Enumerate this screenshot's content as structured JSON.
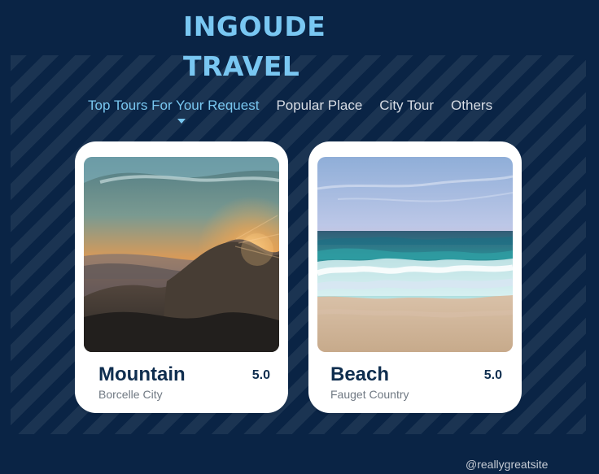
{
  "brand": {
    "line1": "INGOUDE",
    "line2": "TRAVEL"
  },
  "nav": {
    "items": [
      {
        "label": "Top Tours For Your Request"
      },
      {
        "label": "Popular Place"
      },
      {
        "label": "City Tour"
      },
      {
        "label": "Others"
      }
    ]
  },
  "cards": [
    {
      "title": "Mountain",
      "subtitle": "Borcelle City",
      "rating": "5.0",
      "image": "mountain-photo"
    },
    {
      "title": "Beach",
      "subtitle": "Fauget Country",
      "rating": "5.0",
      "image": "beach-photo"
    }
  ],
  "footer": {
    "site": "@reallygreatsite"
  },
  "colors": {
    "background": "#0a2445",
    "accent": "#78c6ef",
    "card": "#ffffff",
    "title": "#0f2e4f"
  }
}
